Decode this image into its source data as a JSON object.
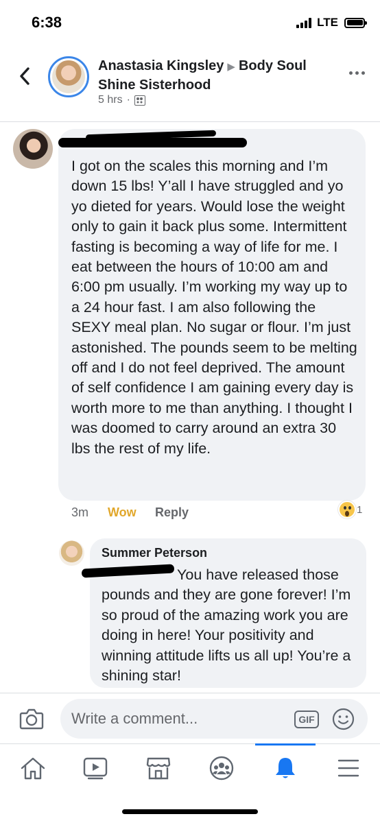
{
  "status_bar": {
    "time": "6:38",
    "network": "LTE"
  },
  "post_header": {
    "author": "Anastasia Kingsley",
    "group": "Body Soul Shine Sisterhood",
    "time": "5 hrs",
    "separator": "·",
    "privacy_icon": "group-members-icon"
  },
  "comment": {
    "text": "I got on the scales this morning and I’m down 15 lbs! Y’all I have struggled and yo yo dieted for years. Would lose the weight only to gain it back plus some. Intermittent fasting is becoming a way of life for me. I eat between the hours of 10:00 am and 6:00 pm usually. I’m working my way up to a 24 hour fast. I am also following the SEXY meal plan. No sugar or flour. I’m just astonished. The pounds seem to be melting off and I do not feel deprived. The amount of self confidence I am gaining every day is worth more to me than anything. I thought I was doomed to carry around an extra 30 lbs the rest of my life.",
    "time": "3m",
    "reaction_label": "Wow",
    "reply_label": "Reply",
    "reaction_count": "1",
    "reaction_icon": "wow-emoji-icon"
  },
  "reply": {
    "author": "Summer Peterson",
    "text": "You have released those pounds and they are gone forever! I’m so proud of the amazing work you are doing in here! Your positivity and winning attitude lifts us all up! You’re a shining star!"
  },
  "composer": {
    "placeholder": "Write a comment...",
    "gif_label": "GIF"
  },
  "tab_bar": {
    "tabs": [
      {
        "icon": "home-icon"
      },
      {
        "icon": "watch-icon"
      },
      {
        "icon": "marketplace-icon"
      },
      {
        "icon": "groups-icon"
      },
      {
        "icon": "notifications-icon",
        "active": true
      },
      {
        "icon": "menu-icon"
      }
    ]
  },
  "colors": {
    "accent": "#1877f2",
    "wow": "#e1a72b",
    "bubble": "#f0f2f5",
    "secondary_text": "#65676b"
  }
}
